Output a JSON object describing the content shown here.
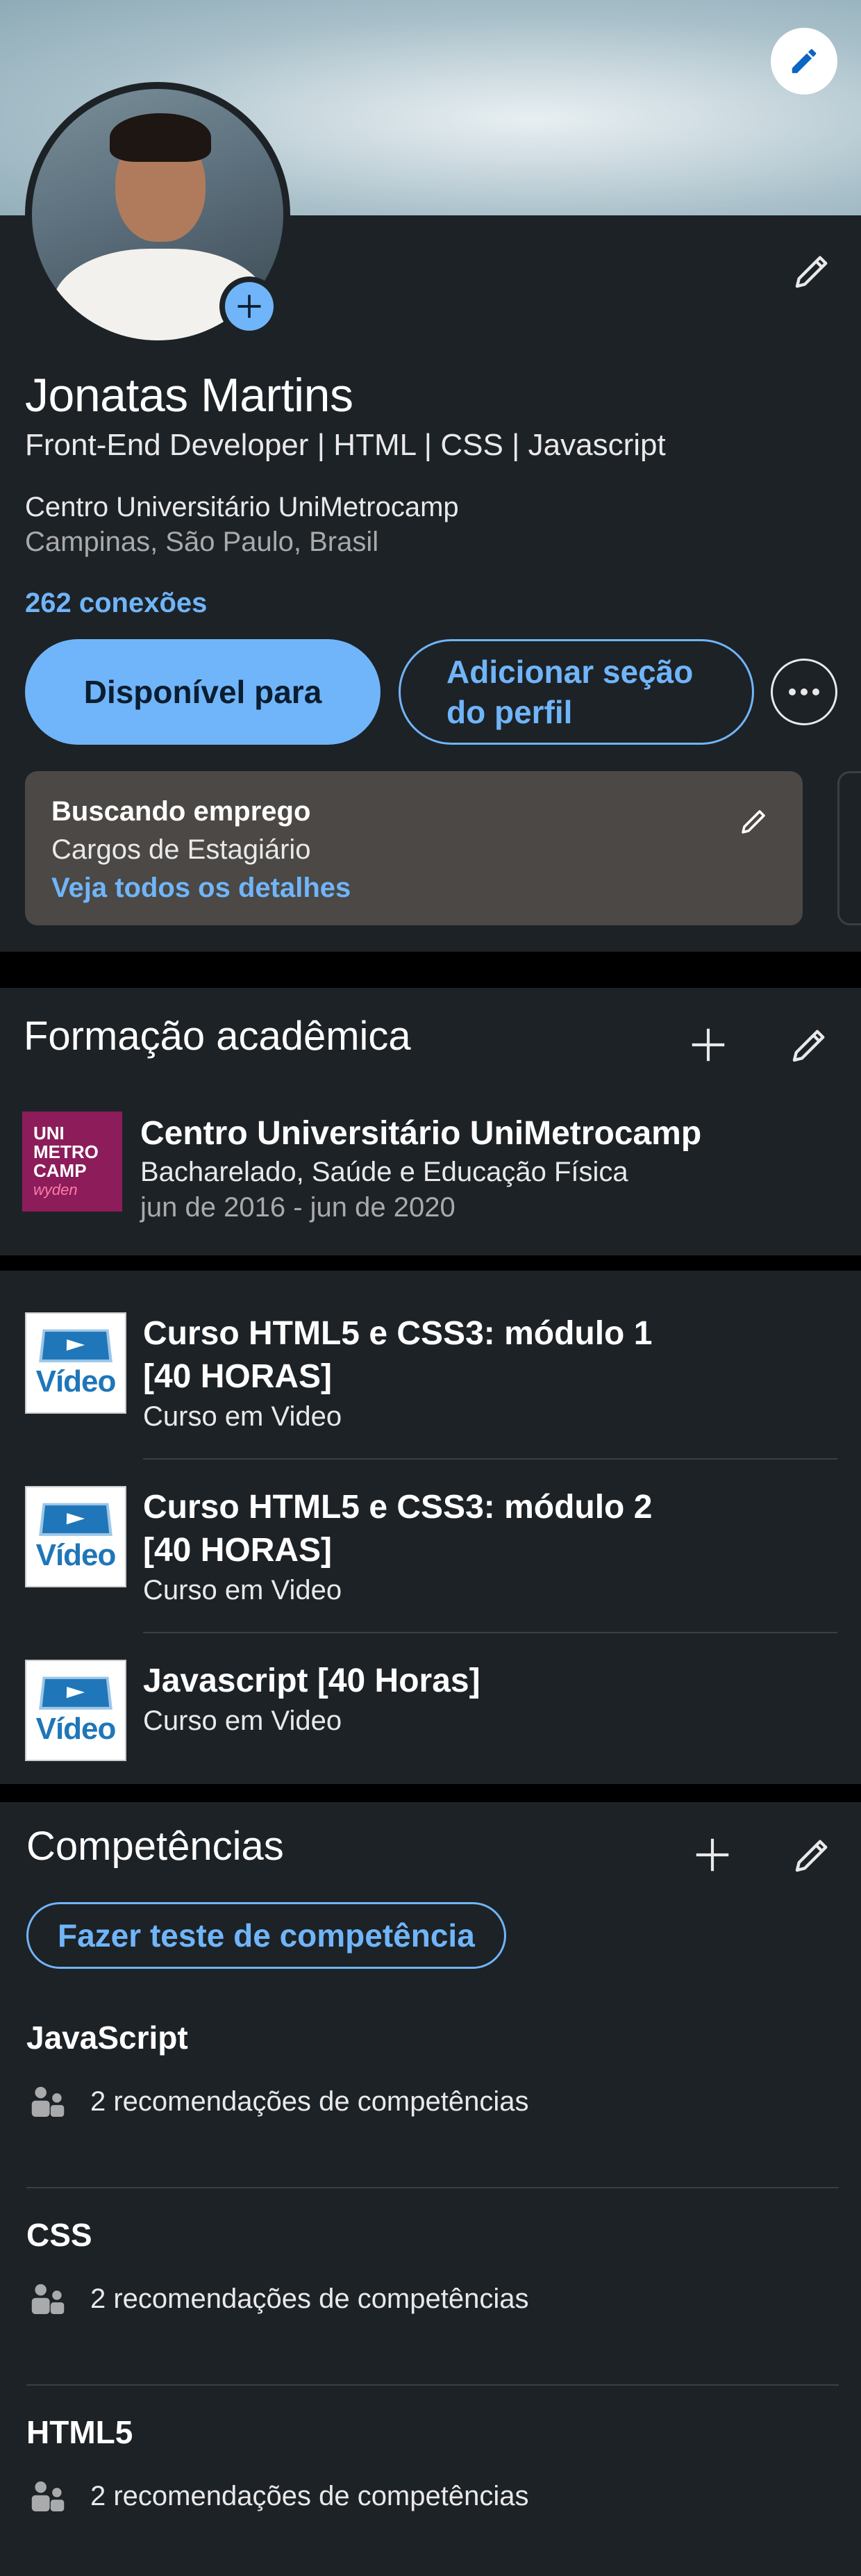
{
  "profile": {
    "name": "Jonatas Martins",
    "headline": "Front-End Developer | HTML | CSS | Javascript",
    "organization": "Centro Universitário UniMetrocamp",
    "location": "Campinas, São Paulo, Brasil",
    "connections": "262 conexões",
    "btn_open_to": "Disponível para",
    "btn_add_section": "Adicionar seção do perfil",
    "open_card": {
      "title": "Buscando emprego",
      "roles": "Cargos de Estagiário",
      "link": "Veja todos os detalhes"
    }
  },
  "education": {
    "title": "Formação acadêmica",
    "items": [
      {
        "logo_lines": [
          "UNI",
          "METRO",
          "CAMP",
          "wyden"
        ],
        "school": "Centro Universitário UniMetrocamp",
        "degree": "Bacharelado, Saúde e Educação Física",
        "period": "jun de 2016 - jun de 2020"
      }
    ]
  },
  "courses": {
    "items": [
      {
        "logo_text": "Vídeo",
        "name_line1": "Curso HTML5 e CSS3: módulo 1",
        "name_line2": "[40 HORAS]",
        "issuer": "Curso em Video"
      },
      {
        "logo_text": "Vídeo",
        "name_line1": "Curso HTML5 e CSS3: módulo 2",
        "name_line2": "[40 HORAS]",
        "issuer": "Curso em Video"
      },
      {
        "logo_text": "Vídeo",
        "name_line1": "Javascript [40 Horas]",
        "issuer": "Curso em Video"
      }
    ]
  },
  "skills": {
    "title": "Competências",
    "test_button": "Fazer teste de competência",
    "items": [
      {
        "name": "JavaScript",
        "endorsements": "2 recomendações de competências"
      },
      {
        "name": "CSS",
        "endorsements": "2 recomendações de competências"
      },
      {
        "name": "HTML5",
        "endorsements": "2 recomendações de competências"
      }
    ]
  },
  "colors": {
    "background": "#1d2226",
    "accent": "#70b5f9",
    "card": "#4b4845"
  },
  "icons": [
    "pencil-icon",
    "plus-icon",
    "more-icon",
    "people-icon"
  ]
}
